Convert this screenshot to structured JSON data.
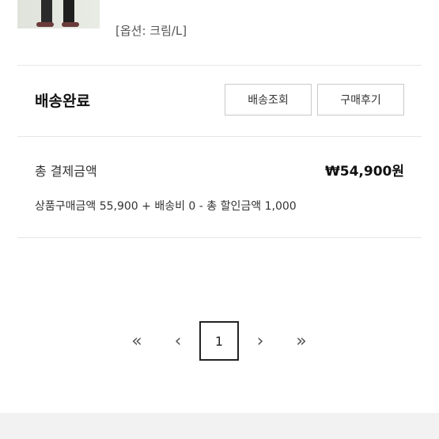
{
  "product": {
    "option_label": "[옵션: 크림/L]"
  },
  "order": {
    "status": "배송완료",
    "track_button": "배송조회",
    "review_button": "구매후기"
  },
  "payment": {
    "total_label": "총 결제금액",
    "total_value": "₩54,900원",
    "breakdown": "상품구매금액 55,900 + 배송비 0 - 총 할인금액 1,000"
  },
  "pagination": {
    "first": "«",
    "prev": "‹",
    "current_page": "1",
    "next": "›",
    "last": "»"
  }
}
